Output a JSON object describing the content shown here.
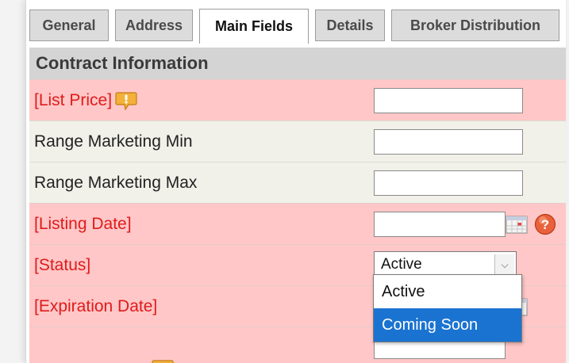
{
  "tabs": [
    {
      "label": "General",
      "active": false
    },
    {
      "label": "Address",
      "active": false
    },
    {
      "label": "Main Fields",
      "active": true
    },
    {
      "label": "Details",
      "active": false
    },
    {
      "label": "Broker Distribution",
      "active": false
    }
  ],
  "section": {
    "title": "Contract Information"
  },
  "rows": {
    "list_price": {
      "label": "[List Price]",
      "value": "",
      "required": true
    },
    "range_min": {
      "label": "Range Marketing Min",
      "value": "",
      "required": false
    },
    "range_max": {
      "label": "Range Marketing Max",
      "value": "",
      "required": false
    },
    "listing_date": {
      "label": "[Listing Date]",
      "value": "",
      "required": true
    },
    "status": {
      "label": "[Status]",
      "selected": "Active",
      "required": true
    },
    "expiration_date": {
      "label": "[Expiration Date]",
      "value": "",
      "required": true
    }
  },
  "status_dropdown": {
    "options": [
      "Active",
      "Coming Soon"
    ],
    "highlighted": "Coming Soon"
  },
  "colors": {
    "required_row_bg": "#ffc7c7",
    "optional_row_bg": "#f1f1ea",
    "required_label": "#e01b1b",
    "highlight": "#1a73d1"
  },
  "icons": {
    "info": "info-exclamation-icon",
    "calendar": "calendar-icon",
    "help": "help-question-icon"
  }
}
